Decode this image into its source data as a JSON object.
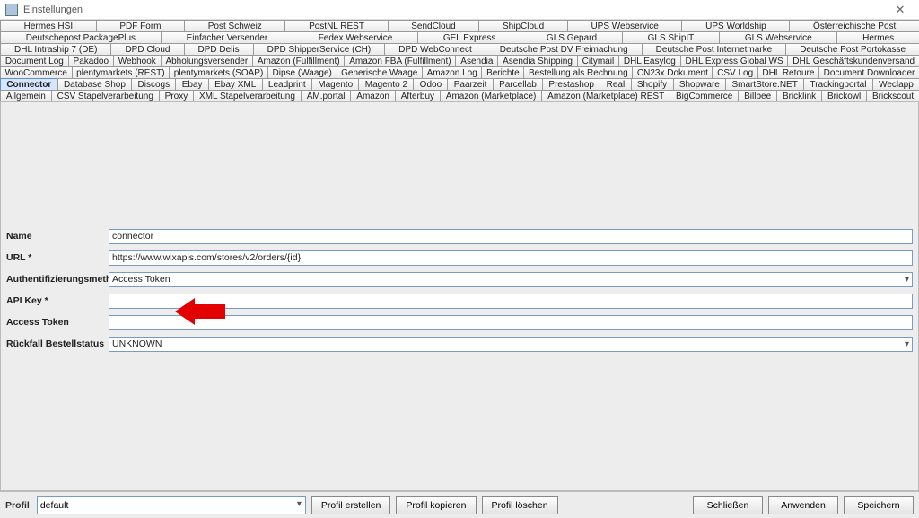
{
  "window": {
    "title": "Einstellungen"
  },
  "tabs": {
    "r1": [
      "Hermes HSI",
      "PDF Form",
      "Post Schweiz",
      "PostNL REST",
      "SendCloud",
      "ShipCloud",
      "UPS Webservice",
      "UPS Worldship",
      "Österreichische Post"
    ],
    "r2": [
      "Deutschepost PackagePlus",
      "Einfacher Versender",
      "Fedex Webservice",
      "GEL Express",
      "GLS Gepard",
      "GLS ShipIT",
      "GLS Webservice",
      "Hermes"
    ],
    "r3": [
      "DHL Intraship 7 (DE)",
      "DPD Cloud",
      "DPD Delis",
      "DPD ShipperService (CH)",
      "DPD WebConnect",
      "Deutsche Post DV Freimachung",
      "Deutsche Post Internetmarke",
      "Deutsche Post Portokasse"
    ],
    "r4": [
      "Document Log",
      "Pakadoo",
      "Webhook",
      "Abholungsversender",
      "Amazon (Fulfillment)",
      "Amazon FBA (Fulfillment)",
      "Asendia",
      "Asendia Shipping",
      "Citymail",
      "DHL Easylog",
      "DHL Express Global WS",
      "DHL Geschäftskundenversand"
    ],
    "r5": [
      "WooCommerce",
      "plentymarkets (REST)",
      "plentymarkets (SOAP)",
      "Dipse (Waage)",
      "Generische Waage",
      "Amazon Log",
      "Berichte",
      "Bestellung als Rechnung",
      "CN23x Dokument",
      "CSV Log",
      "DHL Retoure",
      "Document Downloader"
    ],
    "r6": [
      "Connector",
      "Database Shop",
      "Discogs",
      "Ebay",
      "Ebay XML",
      "Leadprint",
      "Magento",
      "Magento 2",
      "Odoo",
      "Paarzeit",
      "Parcellab",
      "Prestashop",
      "Real",
      "Shopify",
      "Shopware",
      "SmartStore.NET",
      "Trackingportal",
      "Weclapp"
    ],
    "r7": [
      "Allgemein",
      "CSV Stapelverarbeitung",
      "Proxy",
      "XML Stapelverarbeitung",
      "AM.portal",
      "Amazon",
      "Afterbuy",
      "Amazon (Marketplace)",
      "Amazon (Marketplace) REST",
      "BigCommerce",
      "Billbee",
      "Bricklink",
      "Brickowl",
      "Brickscout"
    ]
  },
  "active_tab": "Connector",
  "form": {
    "labels": {
      "name": "Name",
      "url": "URL *",
      "auth": "Authentifizierungsmethode",
      "apikey": "API Key *",
      "accesstoken": "Access Token",
      "fallback": "Rückfall Bestellstatus"
    },
    "values": {
      "name": "connector",
      "url": "https://www.wixapis.com/stores/v2/orders/{id}",
      "auth": "Access Token",
      "apikey": "",
      "accesstoken": "",
      "fallback": "UNKNOWN"
    }
  },
  "bottom": {
    "profile_label": "Profil",
    "profile_value": "default",
    "buttons": {
      "create": "Profil erstellen",
      "copy": "Profil kopieren",
      "delete": "Profil löschen",
      "close": "Schließen",
      "apply": "Anwenden",
      "save": "Speichern"
    }
  }
}
